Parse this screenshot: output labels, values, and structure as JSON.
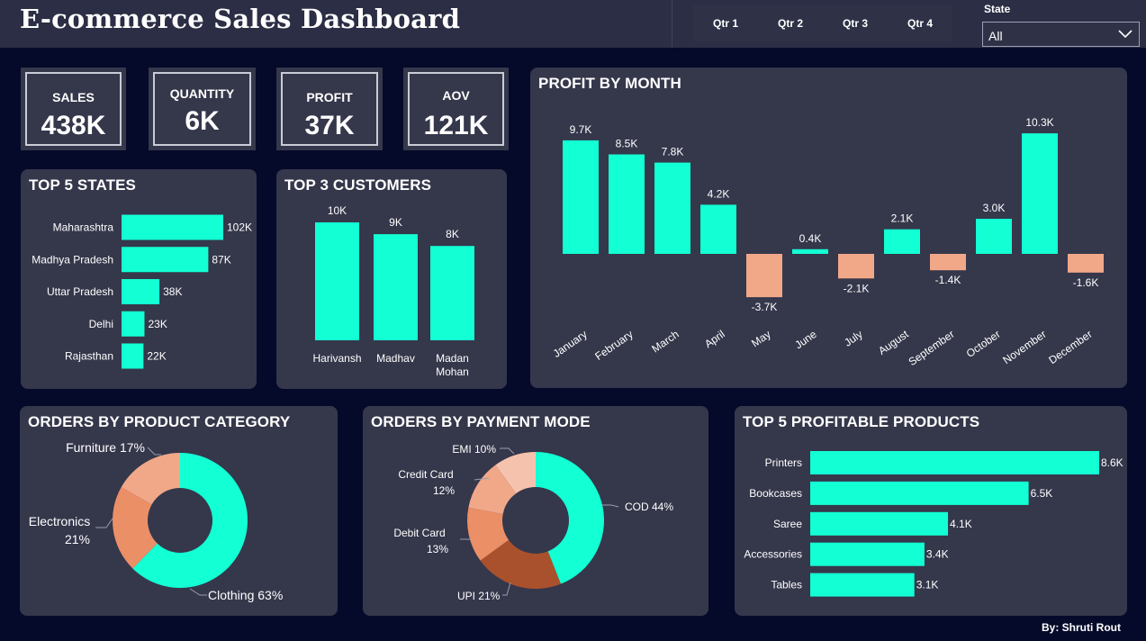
{
  "header": {
    "title": "E-commerce Sales Dashboard",
    "quarters": [
      "Qtr 1",
      "Qtr 2",
      "Qtr 3",
      "Qtr 4"
    ],
    "state_filter": {
      "label": "State",
      "value": "All"
    }
  },
  "kpis": [
    {
      "label": "SALES",
      "value": "438K"
    },
    {
      "label": "QUANTITY",
      "value": "6K"
    },
    {
      "label": "PROFIT",
      "value": "37K"
    },
    {
      "label": "AOV",
      "value": "121K"
    }
  ],
  "colors": {
    "accent": "#13ffd4",
    "negative": "#f0a889",
    "card": "#35374b",
    "background": "#050a2a",
    "donut_shades": [
      "#13ffd4",
      "#eb8f66",
      "#f0a889",
      "#f5c3ad",
      "#a9512c"
    ]
  },
  "footer": "By: Shruti Rout",
  "chart_data": [
    {
      "id": "top_states",
      "type": "bar",
      "orientation": "horizontal",
      "title": "TOP 5 STATES",
      "categories": [
        "Maharashtra",
        "Madhya Pradesh",
        "Uttar Pradesh",
        "Delhi",
        "Rajasthan"
      ],
      "values": [
        102,
        87,
        38,
        23,
        22
      ],
      "data_labels": [
        "102K",
        "87K",
        "38K",
        "23K",
        "22K"
      ],
      "unit": "K"
    },
    {
      "id": "top_customers",
      "type": "bar",
      "orientation": "vertical",
      "title": "TOP 3 CUSTOMERS",
      "categories": [
        "Harivansh",
        "Madhav",
        "Madan Mohan"
      ],
      "values": [
        10,
        9,
        8
      ],
      "data_labels": [
        "10K",
        "9K",
        "8K"
      ],
      "unit": "K"
    },
    {
      "id": "profit_by_month",
      "type": "bar",
      "orientation": "vertical",
      "title": "PROFIT BY MONTH",
      "categories": [
        "January",
        "February",
        "March",
        "April",
        "May",
        "June",
        "July",
        "August",
        "September",
        "October",
        "November",
        "December"
      ],
      "values": [
        9.7,
        8.5,
        7.8,
        4.2,
        -3.7,
        0.4,
        -2.1,
        2.1,
        -1.4,
        3.0,
        10.3,
        -1.6
      ],
      "data_labels": [
        "9.7K",
        "8.5K",
        "7.8K",
        "4.2K",
        "-3.7K",
        "0.4K",
        "-2.1K",
        "2.1K",
        "-1.4K",
        "3.0K",
        "10.3K",
        "-1.6K"
      ],
      "unit": "K"
    },
    {
      "id": "orders_by_category",
      "type": "pie",
      "donut": true,
      "title": "ORDERS BY PRODUCT CATEGORY",
      "slices": [
        {
          "label": "Clothing",
          "value": 63,
          "text": "Clothing 63%"
        },
        {
          "label": "Electronics",
          "value": 21,
          "text": "Electronics 21%"
        },
        {
          "label": "Furniture",
          "value": 17,
          "text": "Furniture 17%"
        }
      ]
    },
    {
      "id": "orders_by_payment",
      "type": "pie",
      "donut": true,
      "title": "ORDERS BY PAYMENT MODE",
      "slices": [
        {
          "label": "COD",
          "value": 44,
          "text": "COD 44%"
        },
        {
          "label": "UPI",
          "value": 21,
          "text": "UPI 21%"
        },
        {
          "label": "Debit Card",
          "value": 13,
          "text": "Debit Card 13%"
        },
        {
          "label": "Credit Card",
          "value": 12,
          "text": "Credit Card 12%"
        },
        {
          "label": "EMI",
          "value": 10,
          "text": "EMI 10%"
        }
      ]
    },
    {
      "id": "top_products",
      "type": "bar",
      "orientation": "horizontal",
      "title": "TOP 5 PROFITABLE PRODUCTS",
      "categories": [
        "Printers",
        "Bookcases",
        "Saree",
        "Accessories",
        "Tables"
      ],
      "values": [
        8.6,
        6.5,
        4.1,
        3.4,
        3.1
      ],
      "data_labels": [
        "8.6K",
        "6.5K",
        "4.1K",
        "3.4K",
        "3.1K"
      ],
      "unit": "K"
    }
  ]
}
